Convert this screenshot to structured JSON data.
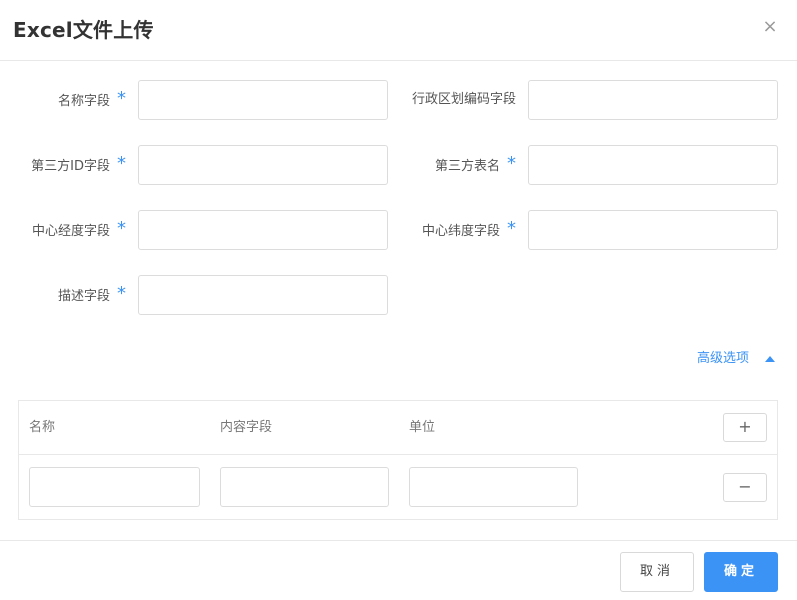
{
  "dialog": {
    "title": "Excel文件上传",
    "close_icon": "×"
  },
  "form": {
    "fields": [
      {
        "label": "名称字段",
        "required": "*",
        "value": ""
      },
      {
        "label": "行政区划编码字段",
        "required": "",
        "value": ""
      },
      {
        "label": "第三方ID字段",
        "required": "*",
        "value": ""
      },
      {
        "label": "第三方表名",
        "required": "*",
        "value": ""
      },
      {
        "label": "中心经度字段",
        "required": "*",
        "value": ""
      },
      {
        "label": "中心纬度字段",
        "required": "*",
        "value": ""
      },
      {
        "label": "描述字段",
        "required": "*",
        "value": ""
      }
    ]
  },
  "advanced": {
    "label": "高级选项",
    "icon": "caret-up-icon"
  },
  "table": {
    "headers": [
      "名称",
      "内容字段",
      "单位"
    ],
    "add_label": "+",
    "remove_label": "−",
    "rows": [
      {
        "name": "",
        "content_field": "",
        "unit": ""
      }
    ]
  },
  "footer": {
    "cancel_label": "取消",
    "ok_label": "确定"
  },
  "colors": {
    "accent": "#3b93f5",
    "border": "#dcdcdc"
  }
}
